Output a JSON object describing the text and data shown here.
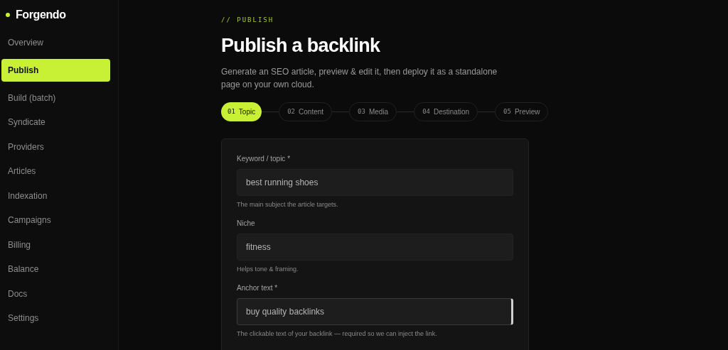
{
  "brand": {
    "name": "Forgendo"
  },
  "sidebar": {
    "items": [
      {
        "label": "Overview",
        "selected": false
      },
      {
        "label": "Publish",
        "selected": true
      },
      {
        "label": "Build (batch)",
        "selected": false
      },
      {
        "label": "Syndicate",
        "selected": false
      },
      {
        "label": "Providers",
        "selected": false
      },
      {
        "label": "Articles",
        "selected": false
      },
      {
        "label": "Indexation",
        "selected": false
      },
      {
        "label": "Campaigns",
        "selected": false
      },
      {
        "label": "Billing",
        "selected": false
      },
      {
        "label": "Balance",
        "selected": false
      },
      {
        "label": "Docs",
        "selected": false
      },
      {
        "label": "Settings",
        "selected": false
      }
    ]
  },
  "header": {
    "eyebrow": "// PUBLISH",
    "title": "Publish a backlink",
    "description": "Generate an SEO article, preview & edit it, then deploy it as a standalone page on your own cloud."
  },
  "steps": [
    {
      "number": "01",
      "label": "Topic",
      "selected": true
    },
    {
      "number": "02",
      "label": "Content",
      "selected": false
    },
    {
      "number": "03",
      "label": "Media",
      "selected": false
    },
    {
      "number": "04",
      "label": "Destination",
      "selected": false
    },
    {
      "number": "05",
      "label": "Preview",
      "selected": false
    }
  ],
  "form": {
    "fields": [
      {
        "label": "Keyword / topic *",
        "value": "best running shoes",
        "help": "The main subject the article targets.",
        "focused": false
      },
      {
        "label": "Niche",
        "value": "fitness",
        "help": "Helps tone & framing.",
        "focused": false
      },
      {
        "label": "Anchor text *",
        "value": "buy quality backlinks",
        "help": "The clickable text of your backlink — required so we can inject the link.",
        "focused": true
      }
    ]
  }
}
